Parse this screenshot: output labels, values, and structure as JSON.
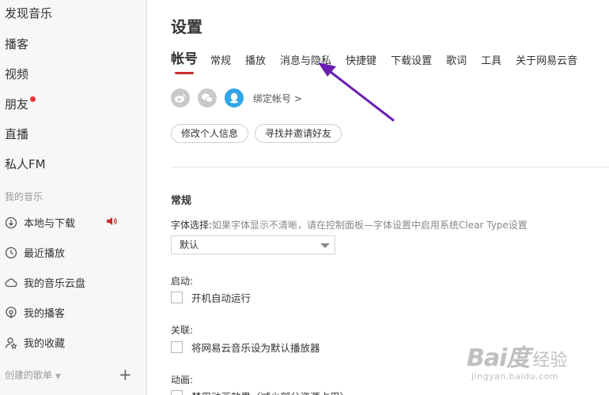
{
  "sidebar": {
    "nav": [
      "发现音乐",
      "播客",
      "视频",
      "朋友",
      "直播",
      "私人FM"
    ],
    "my_music_label": "我的音乐",
    "library": [
      "本地与下载",
      "最近播放",
      "我的音乐云盘",
      "我的播客",
      "我的收藏"
    ],
    "created_playlists_label": "创建的歌单",
    "plus_symbol": "+",
    "chevron_symbol": "▼"
  },
  "main": {
    "title": "设置",
    "tabs": [
      "帐号",
      "常规",
      "播放",
      "消息与隐私",
      "快捷键",
      "下载设置",
      "歌词",
      "工具",
      "关于网易云音"
    ],
    "active_tab_index": 0,
    "bind_account": "绑定帐号 >",
    "buttons": {
      "edit_profile": "修改个人信息",
      "find_friends": "寻找并邀请好友"
    },
    "general": {
      "title": "常规",
      "font_label": "字体选择:",
      "font_hint": "如果字体显示不清晰，请在控制面板—字体设置中启用系统Clear Type设置",
      "font_value": "默认",
      "startup_label": "启动:",
      "startup_option": "开机自动运行",
      "assoc_label": "关联:",
      "assoc_option": "将网易云音乐设为默认播放器",
      "anim_label": "动画:",
      "anim_option": "禁用动画效果（减少部分资源占用）"
    }
  },
  "watermark": {
    "logo": "Bai度",
    "suffix": "经验",
    "url": "jingyan.baidu.com"
  },
  "colors": {
    "accent": "#c62f2f",
    "annotation_arrow": "#6a1fb3",
    "qq": "#2fa6e8"
  }
}
